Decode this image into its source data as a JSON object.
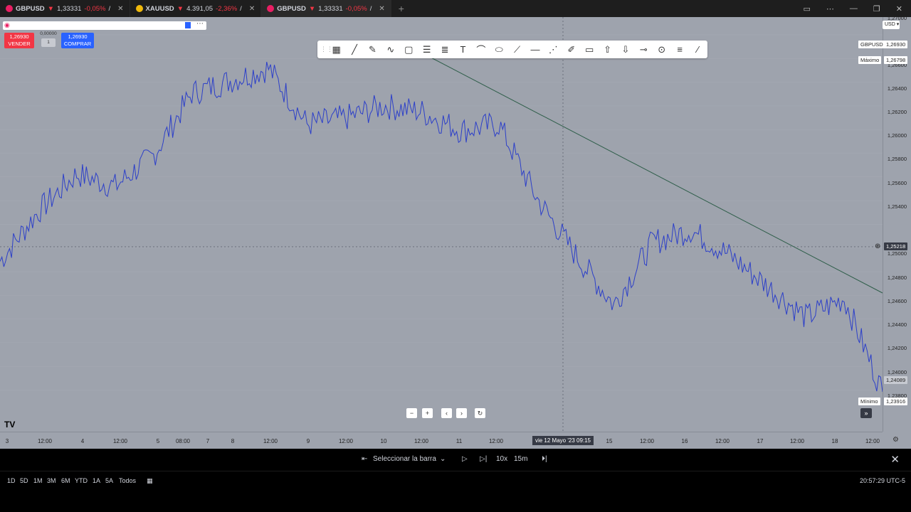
{
  "tabs": [
    {
      "symbol": "GBPUSD",
      "arrow": "▼",
      "price": "1,33331",
      "change": "-0,05%",
      "sep": "/",
      "icon_color": "#e91e63",
      "active": false
    },
    {
      "symbol": "XAUUSD",
      "arrow": "▼",
      "price": "4.391,05",
      "change": "-2,36%",
      "sep": "/",
      "icon_color": "#f0b90b",
      "active": false
    },
    {
      "symbol": "GBPUSD",
      "arrow": "▼",
      "price": "1,33331",
      "change": "-0,05%",
      "sep": "/",
      "icon_color": "#e91e63",
      "active": true
    }
  ],
  "trade": {
    "sell_price": "1,26930",
    "sell_label": "VENDER",
    "spread": "0,00000",
    "qty": "1",
    "buy_price": "1,26930",
    "buy_label": "COMPRAR"
  },
  "currency": "USD",
  "price_axis": {
    "ticks": [
      "1,27000",
      "1,26600",
      "1,26400",
      "1,26200",
      "1,26000",
      "1,25800",
      "1,25600",
      "1,25400",
      "1,25000",
      "1,24800",
      "1,24600",
      "1,24400",
      "1,24200",
      "1,24000",
      "1,23800"
    ],
    "symbol_tag": {
      "label": "GBPUSD",
      "value": "1,26930"
    },
    "max_tag": {
      "label": "Máximo",
      "value": "1,26798"
    },
    "crosshair_value": "1,25218",
    "last_value": "1,24089",
    "min_tag": {
      "label": "Mínimo",
      "value": "1,23916"
    }
  },
  "time_axis": {
    "ticks": [
      "3",
      "12:00",
      "4",
      "12:00",
      "5",
      "08:00",
      "7",
      "8",
      "12:00",
      "9",
      "12:00",
      "10",
      "12:00",
      "11",
      "12:00",
      "15",
      "12:00",
      "16",
      "12:00",
      "17",
      "12:00",
      "18",
      "12:00"
    ],
    "cursor": "vie 12 Mayo '23   09:15"
  },
  "replay": {
    "select_bar": "Seleccionar la barra",
    "speed": "10x",
    "interval": "15m"
  },
  "ranges": [
    "1D",
    "5D",
    "1M",
    "3M",
    "6M",
    "YTD",
    "1A",
    "5A",
    "Todos"
  ],
  "clock": "20:57:29 UTC-5",
  "chart_data": {
    "type": "line",
    "x": [
      "3",
      "12:00",
      "4",
      "12:00",
      "5",
      "08:00",
      "7",
      "8",
      "12:00",
      "9",
      "12:00",
      "10",
      "12:00",
      "11",
      "12:00",
      "12",
      "15",
      "12:00",
      "16",
      "12:00",
      "17",
      "12:00",
      "18",
      "12:00"
    ],
    "series": [
      {
        "values": [
          1.2505,
          1.2545,
          1.2575,
          1.2565,
          1.259,
          1.264,
          1.265,
          1.266,
          1.2615,
          1.262,
          1.263,
          1.2625,
          1.261,
          1.2615,
          1.2555,
          1.251,
          1.247,
          1.252,
          1.253,
          1.251,
          1.2485,
          1.246,
          1.2475,
          1.24
        ]
      }
    ],
    "ylim": [
      1.238,
      1.27
    ],
    "color": "#2c3fc9",
    "trendline": {
      "from": [
        1.268,
        "10"
      ],
      "to": [
        1.248,
        "12:00"
      ]
    }
  }
}
